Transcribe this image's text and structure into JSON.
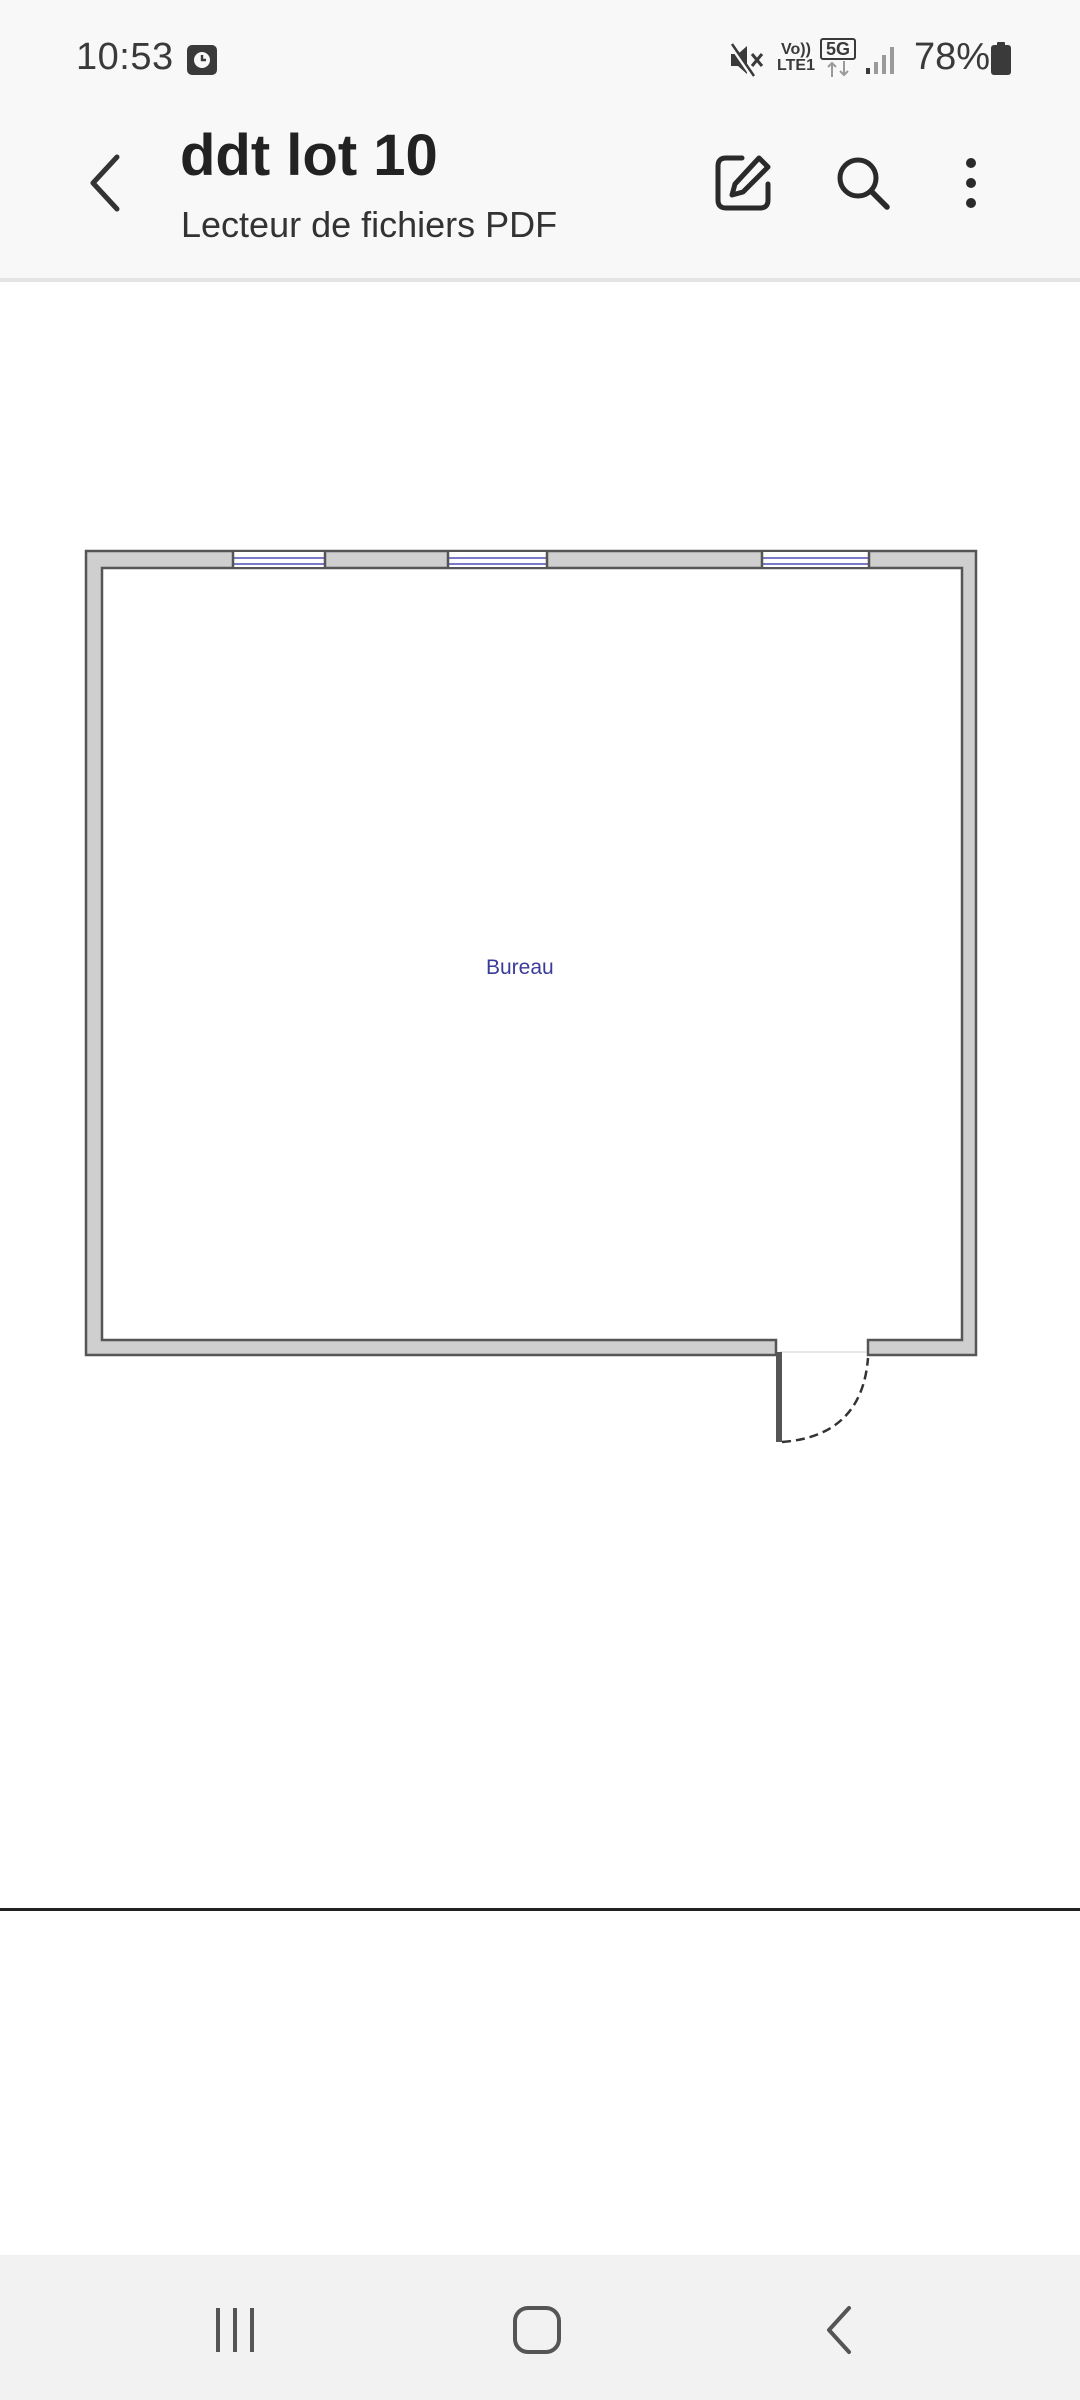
{
  "status_bar": {
    "time": "10:53",
    "battery": "78%",
    "network_top": "Vo))",
    "network_bottom": "LTE1",
    "network_5g": "5G",
    "icons": [
      "alarm-icon",
      "mute-icon",
      "signal-icon",
      "battery-icon"
    ]
  },
  "app_bar": {
    "title": "ddt lot 10",
    "subtitle": "Lecteur de fichiers PDF",
    "icons": [
      "back-arrow-icon",
      "edit-icon",
      "search-icon",
      "more-options-icon"
    ]
  },
  "document": {
    "room_label": "Bureau"
  },
  "nav_bar": {
    "icons": [
      "recent-apps-icon",
      "home-icon",
      "back-icon"
    ]
  },
  "colors": {
    "wall_fill": "#cfcfcf",
    "wall_stroke": "#555555",
    "window": "#7a7ac8",
    "label": "#3b3b9a"
  }
}
